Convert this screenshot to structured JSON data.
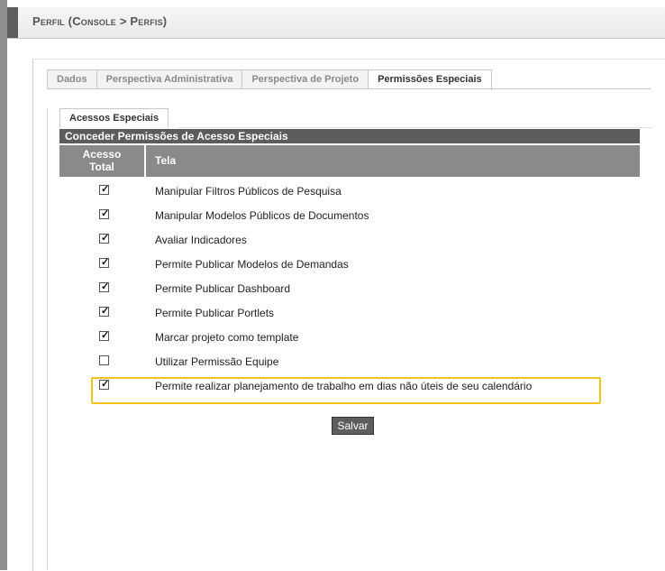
{
  "page": {
    "title": "Perfil (Console > Perfis)"
  },
  "tabs": [
    {
      "label": "Dados",
      "active": false
    },
    {
      "label": "Perspectiva Administrativa",
      "active": false
    },
    {
      "label": "Perspectiva de Projeto",
      "active": false
    },
    {
      "label": "Permissões Especiais",
      "active": true
    }
  ],
  "subtab": {
    "label": "Acessos Especiais"
  },
  "table": {
    "section_title": "Conceder Permissões de Acesso Especiais",
    "col_acesso": "Acesso Total",
    "col_tela": "Tela",
    "rows": [
      {
        "label": "Manipular Filtros Públicos de Pesquisa",
        "checked": true
      },
      {
        "label": "Manipular Modelos Públicos de Documentos",
        "checked": true
      },
      {
        "label": "Avaliar Indicadores",
        "checked": true
      },
      {
        "label": "Permite Publicar Modelos de Demandas",
        "checked": true
      },
      {
        "label": "Permite Publicar Dashboard",
        "checked": true
      },
      {
        "label": "Permite Publicar Portlets",
        "checked": true
      },
      {
        "label": "Marcar projeto como template",
        "checked": true
      },
      {
        "label": "Utilizar Permissão Equipe",
        "checked": false
      },
      {
        "label": "Permite realizar planejamento de trabalho em dias não úteis de seu calendário",
        "checked": true,
        "highlighted": true
      }
    ]
  },
  "actions": {
    "save_label": "Salvar"
  },
  "colors": {
    "highlight": "#f0c419",
    "header_dark": "#5c5c5c",
    "header_mid": "#8a8a8a"
  }
}
